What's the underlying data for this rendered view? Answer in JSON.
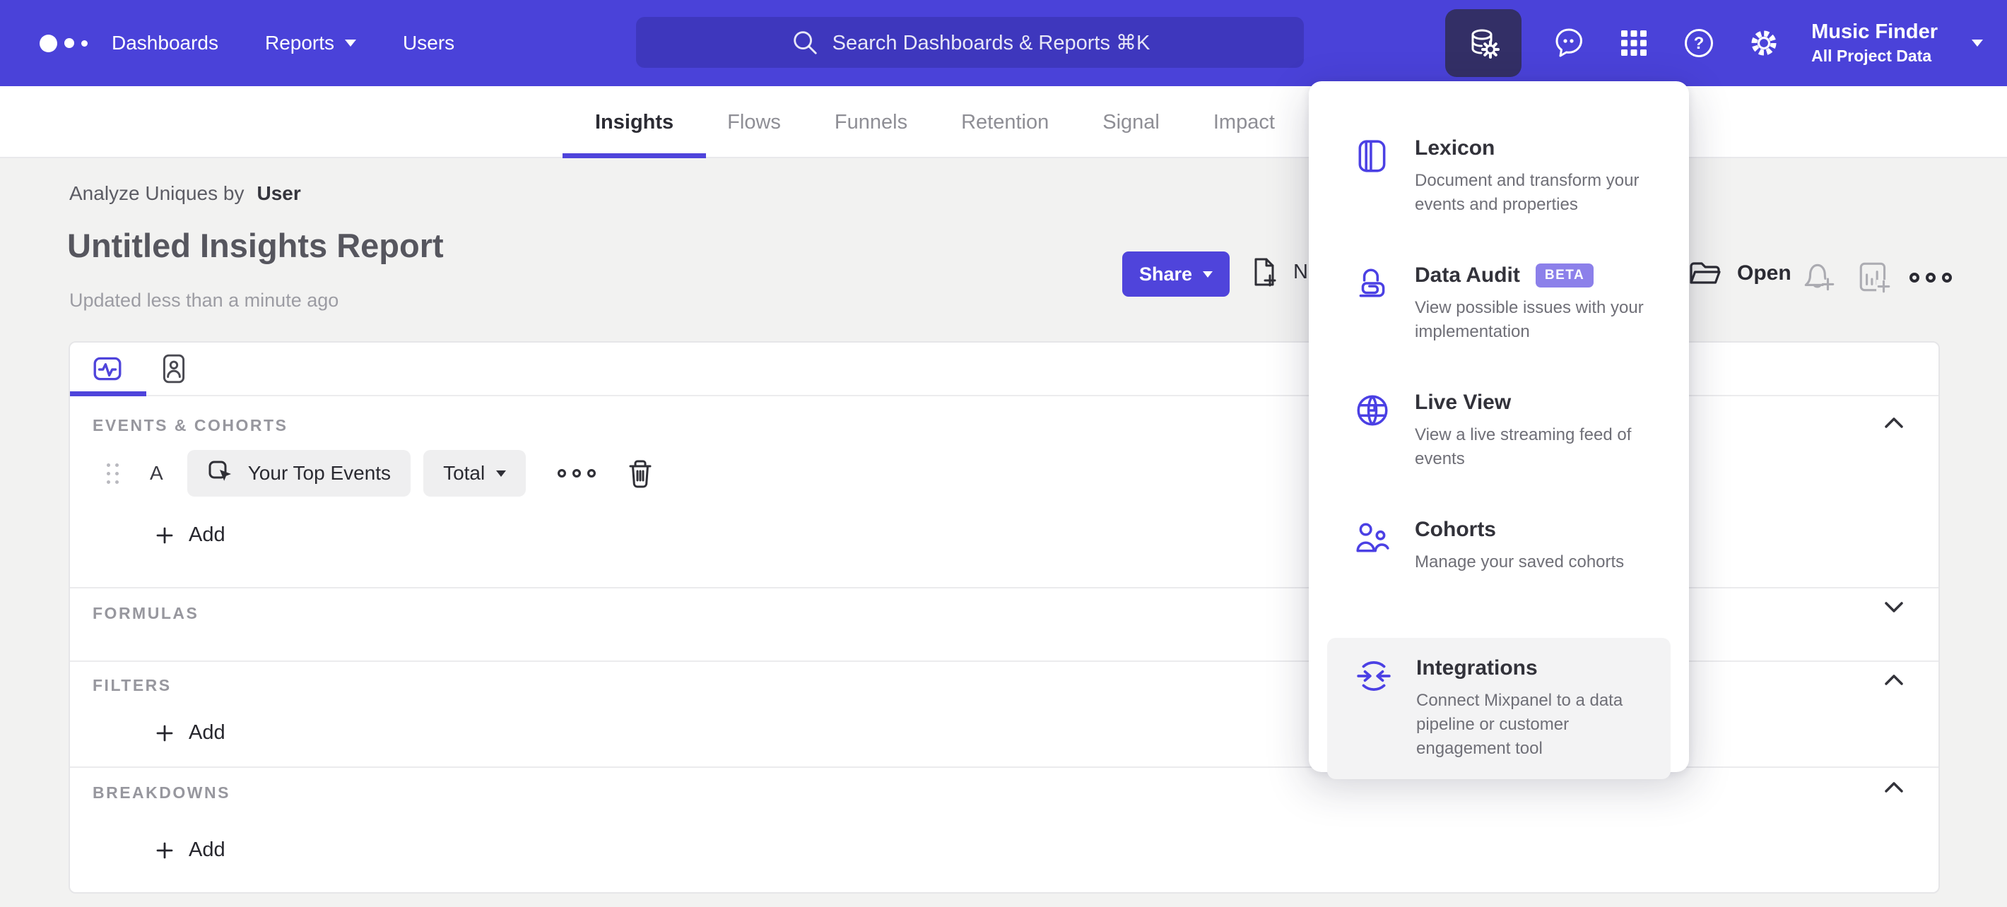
{
  "nav": {
    "items": [
      {
        "label": "Dashboards"
      },
      {
        "label": "Reports"
      },
      {
        "label": "Users"
      }
    ],
    "search": {
      "placeholder": "Search Dashboards & Reports ⌘K"
    },
    "project": {
      "name": "Music Finder",
      "scope": "All Project Data"
    }
  },
  "tabs": [
    {
      "label": "Insights",
      "active": true
    },
    {
      "label": "Flows"
    },
    {
      "label": "Funnels"
    },
    {
      "label": "Retention"
    },
    {
      "label": "Signal"
    },
    {
      "label": "Impact"
    }
  ],
  "header": {
    "analyze_label": "Analyze Uniques by",
    "analyze_value": "User",
    "title": "Untitled Insights Report",
    "updated": "Updated less than a minute ago",
    "share": "Share",
    "new": "New",
    "open": "Open"
  },
  "builder": {
    "events_label": "EVENTS & COHORTS",
    "event_row": {
      "letter": "A",
      "event": "Your Top Events",
      "metric": "Total"
    },
    "add": "Add",
    "formulas_label": "FORMULAS",
    "filters_label": "FILTERS",
    "breakdowns_label": "BREAKDOWNS"
  },
  "menu": {
    "items": [
      {
        "title": "Lexicon",
        "desc": "Document and transform your events and properties"
      },
      {
        "title": "Data Audit",
        "badge": "BETA",
        "desc": "View possible issues with your implementation"
      },
      {
        "title": "Live View",
        "desc": "View a live streaming feed of events"
      },
      {
        "title": "Cohorts",
        "desc": "Manage your saved cohorts"
      },
      {
        "title": "Integrations",
        "desc": "Connect Mixpanel to a data pipeline or customer engagement tool"
      }
    ]
  },
  "colors": {
    "nav": "#4A42D9",
    "accent": "#4F44DB",
    "beta_badge": "#8C80EA",
    "active_tool_bg": "#332F66"
  }
}
